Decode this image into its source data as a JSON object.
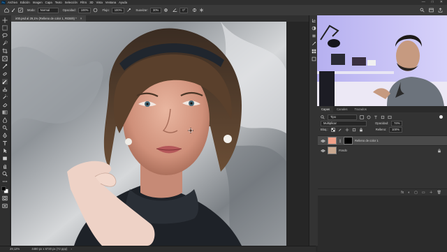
{
  "menubar": {
    "items": [
      "Archivo",
      "Edición",
      "Imagen",
      "Capa",
      "Texto",
      "Selección",
      "Filtro",
      "3D",
      "Vista",
      "Ventana",
      "Ayuda"
    ],
    "min": "—",
    "max": "□",
    "close": "✕"
  },
  "options": {
    "mode_label": "Modo:",
    "mode_value": "Normal",
    "opacity_label": "Opacidad:",
    "opacity_value": "100%",
    "flow_label": "Flujo:",
    "flow_value": "100%",
    "smooth_label": "Suavizar:",
    "smooth_value": "30%",
    "angle_value": "0°"
  },
  "document": {
    "tab_title": "ir00.psd al 29,1% (Relleno de color 1, RGB/8) *",
    "close": "×"
  },
  "status": {
    "zoom": "29,12%",
    "info": "4480 px x 6720 px (72 ppp)"
  },
  "layers": {
    "tabs": [
      "Capas",
      "Canales",
      "Trazados"
    ],
    "filter_label": "Tipo",
    "blend_mode": "Multiplicar",
    "opacity_label": "Opacidad:",
    "opacity_value": "74%",
    "lock_label": "Bloq.:",
    "fill_label": "Relleno:",
    "fill_value": "100%",
    "items": [
      {
        "name": "Relleno de color 1",
        "thumb_color": "#f0a088"
      },
      {
        "name": "Fondo",
        "thumb_color": "#c8a890"
      }
    ],
    "foot_icons": [
      "fx",
      "◐",
      "▢",
      "▭",
      "＋",
      "🗑"
    ]
  },
  "colors": {
    "accent": "#f0a088",
    "panel": "#333333"
  }
}
